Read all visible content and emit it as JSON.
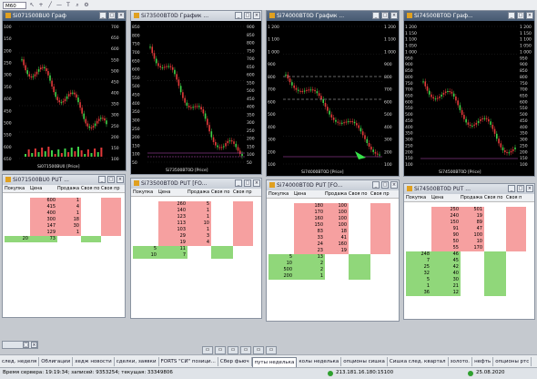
{
  "toolbar": {
    "timeframe": "M60"
  },
  "windows": {
    "c1": {
      "title": "Si071500BU0 Граф",
      "label": "Si071500BU0 [Price]",
      "ticks": [
        "700",
        "650",
        "600",
        "550",
        "500",
        "450",
        "400",
        "350",
        "300",
        "250",
        "200",
        "150",
        "100"
      ],
      "lticks": [
        "100",
        "150",
        "200",
        "250",
        "300",
        "350",
        "400",
        "450",
        "500",
        "550",
        "600",
        "650"
      ]
    },
    "c2": {
      "title": "Si73500BT0D График ...",
      "label": "Si73500BT0D [Price]",
      "ticks": [
        "900",
        "850",
        "800",
        "750",
        "700",
        "650",
        "600",
        "550",
        "500",
        "450",
        "400",
        "350",
        "300",
        "250",
        "200",
        "150",
        "100",
        "50"
      ],
      "lticks": [
        "850",
        "800",
        "750",
        "700",
        "650",
        "600",
        "550",
        "500",
        "450",
        "400",
        "350",
        "300",
        "250",
        "200",
        "150",
        "100",
        "50"
      ]
    },
    "c3": {
      "title": "Si74000BT0D График ...",
      "label": "Si74000BT0D [Price]",
      "ticks": [
        "1 200",
        "1 100",
        "1 000",
        "900",
        "800",
        "700",
        "600",
        "500",
        "400",
        "300",
        "200",
        "100"
      ],
      "lticks": [
        "1 200",
        "1 100",
        "1 000",
        "900",
        "800",
        "700",
        "600",
        "500",
        "400",
        "300",
        "200",
        "100"
      ]
    },
    "c4": {
      "title": "Si74500BT0D Граф...",
      "label": "Si74500BT0D [Price]",
      "ticks": [
        "1 200",
        "1 150",
        "1 100",
        "1 050",
        "1 000",
        "950",
        "900",
        "850",
        "800",
        "750",
        "700",
        "650",
        "600",
        "550",
        "500",
        "450",
        "400",
        "350",
        "300",
        "250",
        "200",
        "150",
        "100"
      ],
      "lticks": [
        "1 200",
        "1 150",
        "1 100",
        "1 050",
        "1 000",
        "950",
        "900",
        "850",
        "800",
        "750",
        "700",
        "650",
        "600",
        "550",
        "500",
        "450",
        "400",
        "350",
        "300",
        "250",
        "200",
        "150",
        "100"
      ]
    },
    "t1": {
      "title": "Si071500BU0 PUT ...",
      "cols": [
        "Покупка",
        "Цена",
        "Продажа",
        "Своя по",
        "Своя пр"
      ],
      "asks": [
        [
          "600",
          "1"
        ],
        [
          "415",
          "4"
        ],
        [
          "400",
          "1"
        ],
        [
          "300",
          "18"
        ],
        [
          "147",
          "30"
        ],
        [
          "129",
          "1"
        ]
      ],
      "bids": [
        [
          "20",
          "73"
        ]
      ]
    },
    "t2": {
      "title": "Si73500BT0D PUT [FO...",
      "cols": [
        "Покупка",
        "Цена",
        "Продажа",
        "Своя по",
        "Своя пр"
      ],
      "asks": [
        [
          "260",
          "5"
        ],
        [
          "140",
          "1"
        ],
        [
          "123",
          "1"
        ],
        [
          "113",
          "10"
        ],
        [
          "103",
          "1"
        ],
        [
          "29",
          "3"
        ],
        [
          "19",
          "4"
        ]
      ],
      "bids": [
        [
          "5",
          "11"
        ],
        [
          "10",
          "7"
        ]
      ]
    },
    "t3": {
      "title": "Si74000BT0D PUT [FO...",
      "cols": [
        "Покупка",
        "Цена",
        "Продажа",
        "Своя по",
        "Своя пр"
      ],
      "asks": [
        [
          "180",
          "100"
        ],
        [
          "170",
          "100"
        ],
        [
          "160",
          "100"
        ],
        [
          "150",
          "100"
        ],
        [
          "83",
          "18"
        ],
        [
          "33",
          "41"
        ],
        [
          "24",
          "160"
        ],
        [
          "23",
          "19"
        ]
      ],
      "bids": [
        [
          "5",
          "13"
        ],
        [
          "10",
          "2"
        ],
        [
          "500",
          "2"
        ],
        [
          "200",
          "1"
        ]
      ]
    },
    "t4": {
      "title": "Si74500BT0D PUT ...",
      "cols": [
        "Покупка",
        "Цена",
        "Продажа",
        "Своя по",
        "Своя п"
      ],
      "asks": [
        [
          "250",
          "501"
        ],
        [
          "240",
          "19"
        ],
        [
          "150",
          "89"
        ],
        [
          "91",
          "47"
        ],
        [
          "90",
          "100"
        ],
        [
          "50",
          "10"
        ],
        [
          "55",
          "170"
        ]
      ],
      "bids": [
        [
          "248",
          "46"
        ],
        [
          "7",
          "45"
        ],
        [
          "25",
          "42"
        ],
        [
          "32",
          "40"
        ],
        [
          "5",
          "30"
        ],
        [
          "1",
          "21"
        ],
        [
          "36",
          "12"
        ]
      ]
    }
  },
  "tabs": [
    "след. неделя",
    "Облигации",
    "хедж новости",
    "сделки, заявки",
    "FORTS \"СИ\" позици...",
    "Сбер фьюч",
    "путы неделька",
    "колы неделька",
    "опционы сишка",
    "Сишка след. квартал",
    "золото.",
    "нефть",
    "опционы ртс"
  ],
  "active_tab": "путы неделька",
  "status": {
    "server_time": "Время сервера: 19:19:34; записей: 9353254; текущая: 33349806",
    "ip": "213.181.16.180:15100",
    "date": "25.08.2020"
  }
}
